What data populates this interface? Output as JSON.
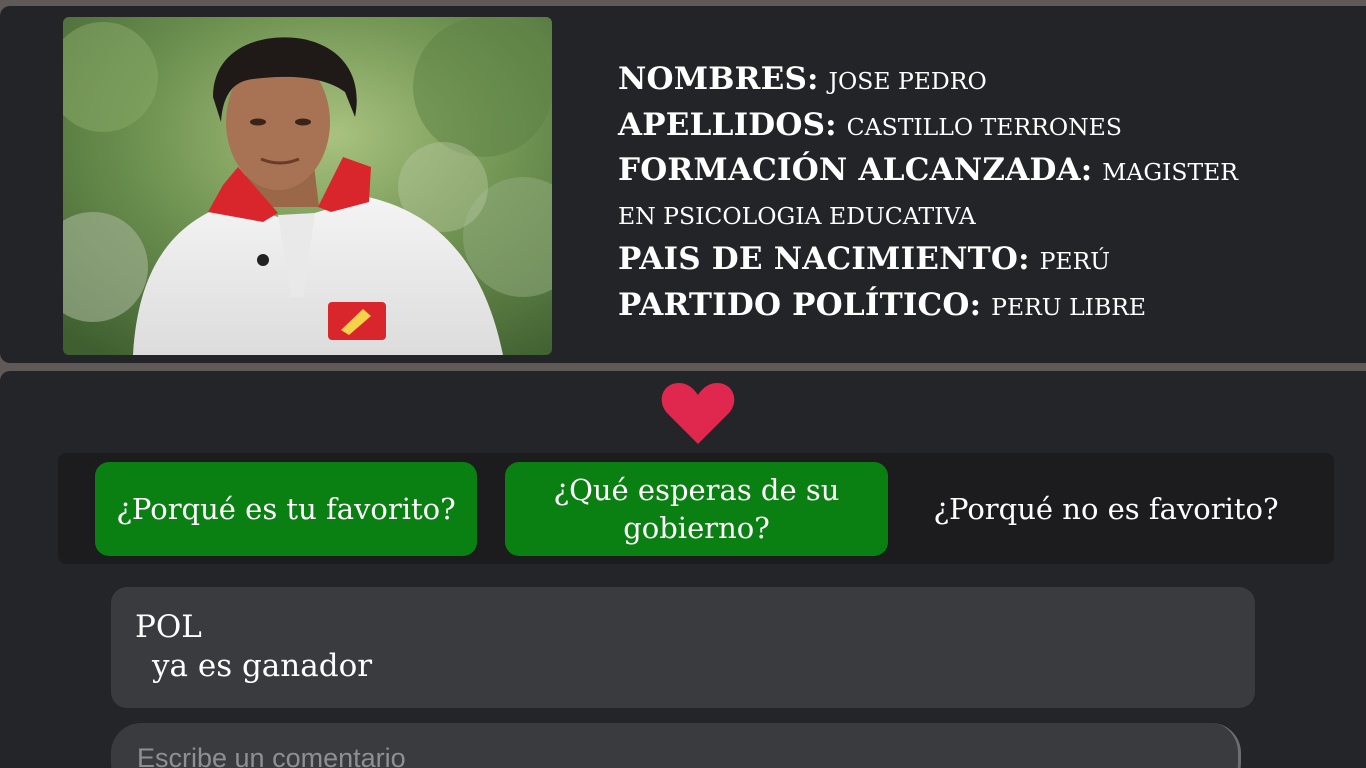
{
  "profile": {
    "photo": {
      "alt": "Candidate photo"
    },
    "fields": [
      {
        "label": "NOMBRES:",
        "value": "JOSE PEDRO"
      },
      {
        "label": "APELLIDOS:",
        "value": "CASTILLO TERRONES"
      },
      {
        "label": "FORMACIÓN ALCANZADA:",
        "value": "MAGISTER",
        "value_cont": "EN PSICOLOGIA EDUCATIVA"
      },
      {
        "label": "PAIS DE NACIMIENTO:",
        "value": "PERÚ"
      },
      {
        "label": "PARTIDO POLÍTICO:",
        "value": "PERU LIBRE"
      }
    ]
  },
  "favorite": {
    "icon": "heart-icon",
    "color": "#e0284f"
  },
  "tabs": [
    {
      "label": "¿Porqué es tu favorito?",
      "active": true
    },
    {
      "label": "¿Qué esperas de su gobierno?",
      "active": true
    },
    {
      "label": "¿Porqué no es favorito?",
      "active": false
    }
  ],
  "comments": [
    {
      "author": "POL",
      "text": "ya es ganador"
    }
  ],
  "comment_input": {
    "placeholder": "Escribe un comentario"
  },
  "colors": {
    "panel_bg": "#232427",
    "tab_active": "#0a8012",
    "comment_bg": "#3a3b3e"
  }
}
